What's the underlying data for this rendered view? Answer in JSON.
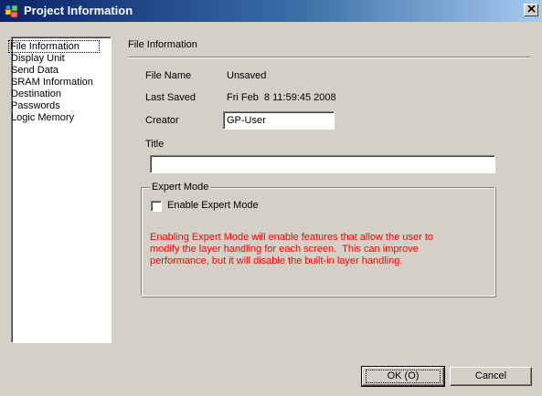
{
  "window": {
    "title": "Project Information"
  },
  "nav": {
    "items": [
      {
        "label": "File Information",
        "selected": true
      },
      {
        "label": "Display Unit"
      },
      {
        "label": "Send Data"
      },
      {
        "label": "SRAM Information"
      },
      {
        "label": "Destination"
      },
      {
        "label": "Passwords"
      },
      {
        "label": "Logic Memory"
      }
    ]
  },
  "section": {
    "heading": "File Information"
  },
  "file_info": {
    "file_name_label": "File Name",
    "file_name_value": "Unsaved",
    "last_saved_label": "Last Saved",
    "last_saved_value": "Fri Feb  8 11:59:45 2008",
    "creator_label": "Creator",
    "creator_value": "GP-User",
    "title_label": "Title",
    "title_value": ""
  },
  "expert_mode": {
    "group_label": "Expert Mode",
    "checkbox_label": "Enable Expert Mode",
    "checked": false,
    "warning_line1": "Enabling Expert Mode will enable features that allow the user to",
    "warning_line2": "modify the layer handling for each screen.  This can improve",
    "warning_line3": "performance, but it will disable the built-in layer handling."
  },
  "buttons": {
    "ok_label": "OK (O)",
    "cancel_label": "Cancel"
  },
  "colors": {
    "warning_text": "#ff0000",
    "dialog_bg": "#d4d0c8",
    "title_bar_start": "#0a246a",
    "title_bar_end": "#a6caf0"
  }
}
